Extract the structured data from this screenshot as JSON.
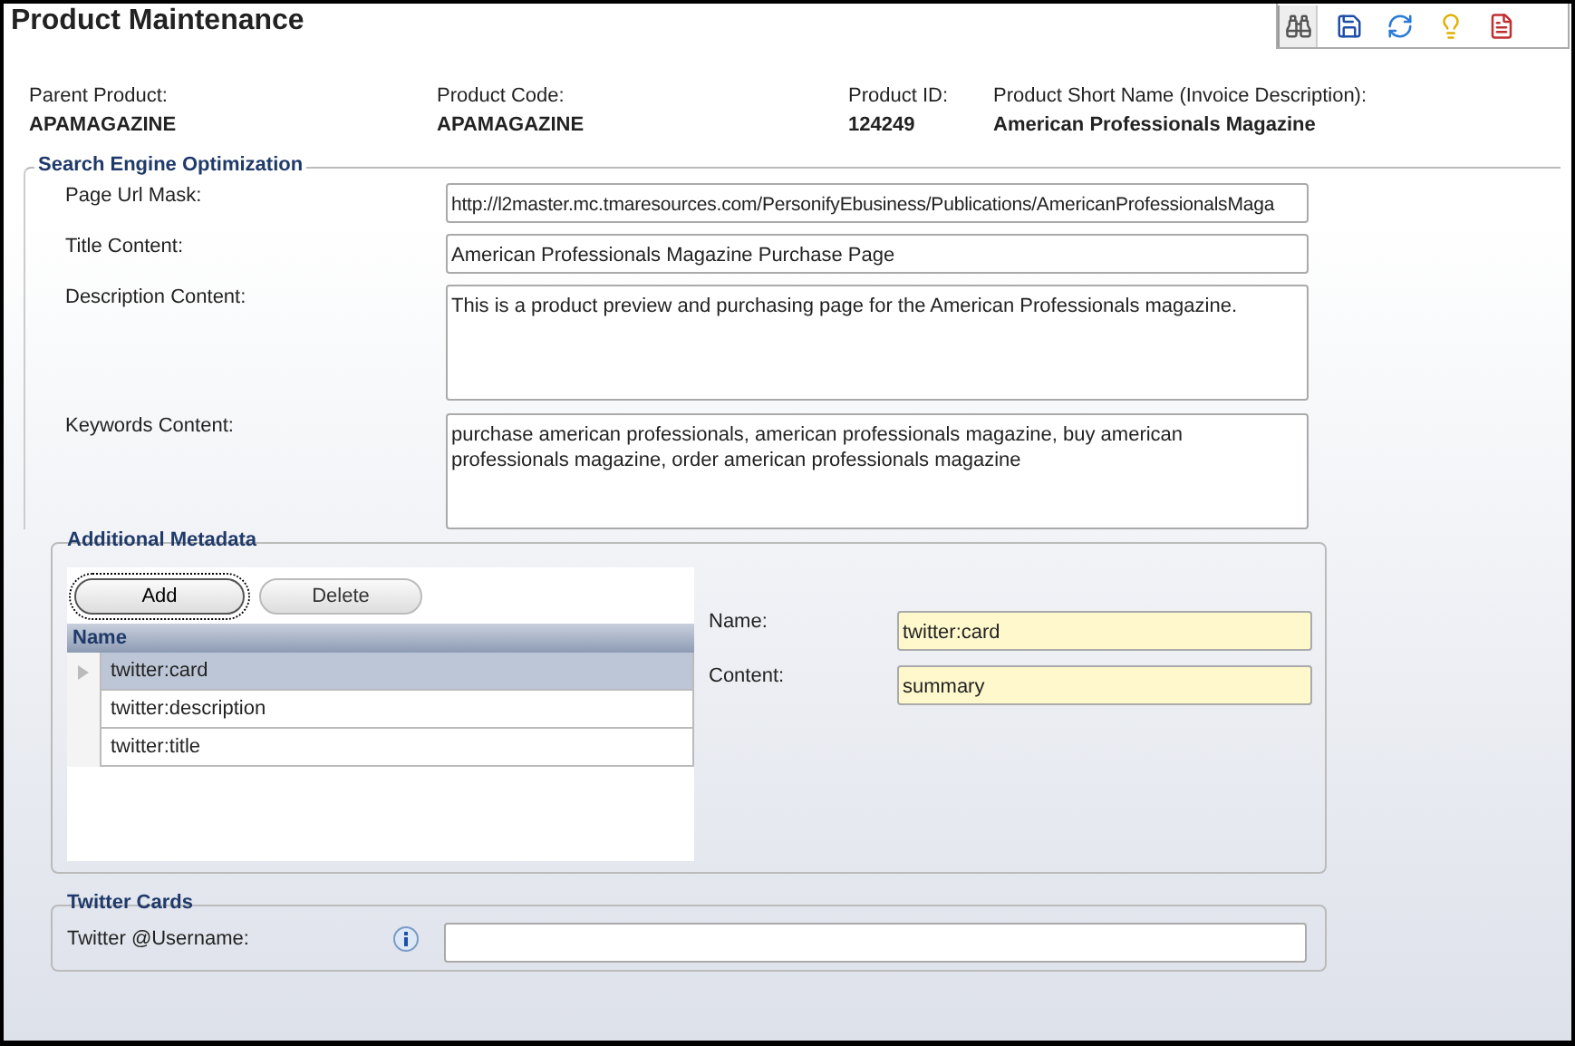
{
  "window": {
    "title": "Product Maintenance"
  },
  "toolbar": [
    {
      "kind": "find",
      "selected": true
    },
    {
      "kind": "save",
      "selected": false
    },
    {
      "kind": "refresh",
      "selected": false
    },
    {
      "kind": "hint",
      "selected": false
    },
    {
      "kind": "report",
      "selected": false
    }
  ],
  "product_info": [
    {
      "label": "Parent Product:",
      "value": "APAMAGAZINE"
    },
    {
      "label": "Product Code:",
      "value": "APAMAGAZINE"
    },
    {
      "label": "Product ID:",
      "value": "124249"
    },
    {
      "label": "Product Short Name (Invoice Description):",
      "value": "American Professionals Magazine"
    }
  ],
  "seo": {
    "legend": "Search Engine Optimization",
    "fields": [
      {
        "kind": "line",
        "label": "Page Url Mask:",
        "value": "http://l2master.mc.tmaresources.com/PersonifyEbusiness/Publications/AmericanProfessionalsMaga"
      },
      {
        "kind": "line",
        "label": "Title Content:",
        "value": "American Professionals Magazine Purchase Page"
      },
      {
        "kind": "area",
        "label": "Description Content:",
        "value": "This is a product preview and purchasing page for the American Professionals magazine."
      },
      {
        "kind": "area",
        "label": "Keywords Content:",
        "value": "purchase american professionals, american professionals magazine, buy american professionals magazine, order american professionals magazine"
      }
    ]
  },
  "metadata": {
    "legend": "Additional Metadata",
    "buttons": [
      {
        "label": "Add",
        "focused": true
      },
      {
        "label": "Delete",
        "focused": false
      }
    ],
    "grid": {
      "column": "Name",
      "rows": [
        {
          "name": "twitter:card",
          "selected": true
        },
        {
          "name": "twitter:description",
          "selected": false
        },
        {
          "name": "twitter:title",
          "selected": false
        }
      ]
    },
    "detail": [
      {
        "label": "Name:",
        "value": "twitter:card"
      },
      {
        "label": "Content:",
        "value": "summary"
      }
    ]
  },
  "twitter": {
    "legend": "Twitter Cards",
    "label": "Twitter @Username:"
  }
}
